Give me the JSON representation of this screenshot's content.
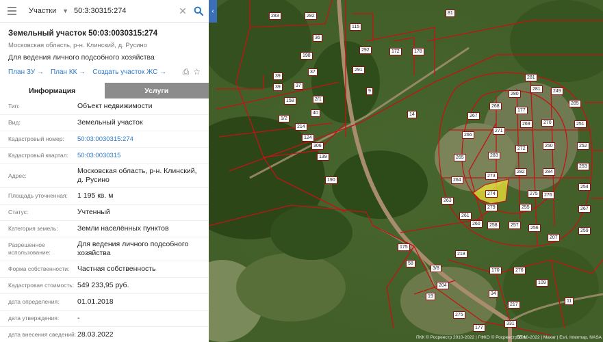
{
  "search": {
    "layer": "Участки",
    "query": "50:3:30315:274"
  },
  "header": {
    "title": "Земельный участок 50:03:0030315:274",
    "address": "Московская область, р-н. Клинский, д. Русино",
    "purpose": "Для ведения личного подсобного хозяйства",
    "links": [
      "План ЗУ →",
      "План КК →",
      "Создать участок ЖС →"
    ]
  },
  "tabs": [
    {
      "label": "Информация"
    },
    {
      "label": "Услуги"
    }
  ],
  "info": [
    {
      "key": "Тип:",
      "value": "Объект недвижимости"
    },
    {
      "key": "Вид:",
      "value": "Земельный участок"
    },
    {
      "key": "Кадастровый номер:",
      "value": "50:03:0030315:274"
    },
    {
      "key": "Кадастровый квартал:",
      "value": "50:03:0030315"
    },
    {
      "key": "Адрес:",
      "value": "Московская область, р-н. Клинский, д. Русино"
    },
    {
      "key": "Площадь уточненная:",
      "value": "1 195 кв. м"
    },
    {
      "key": "Статус:",
      "value": "Учтенный"
    },
    {
      "key": "Категория земель:",
      "value": "Земли населённых пунктов"
    },
    {
      "key": "Разрешенное использование:",
      "value": "Для ведения личного подсобного хозяйства"
    },
    {
      "key": "Форма собственности:",
      "value": "Частная собственность"
    },
    {
      "key": "Кадастровая стоимость:",
      "value": "549 233,95 руб."
    },
    {
      "key": "дата определения:",
      "value": "01.01.2018"
    },
    {
      "key": "дата утверждения:",
      "value": "-"
    },
    {
      "key": "дата внесения сведений:",
      "value": "28.03.2022"
    }
  ],
  "map": {
    "selected_label": "274",
    "scale": "60 м",
    "attribution": "ПКК © Росреестр 2010-2022 | ГФКО © Росреестр 2010-2022 | Maxar | Esri, Intermap, NASA",
    "labels": [
      "283",
      "282",
      "81",
      "115",
      "36",
      "292",
      "172",
      "178",
      "198",
      "37",
      "291",
      "39",
      "39",
      "37",
      "9",
      "281",
      "280",
      "281",
      "249",
      "158",
      "14",
      "268",
      "285",
      "177",
      "2/1",
      "40",
      "267",
      "269",
      "270",
      "251",
      "1/2",
      "214",
      "271",
      "266",
      "124",
      "306",
      "272",
      "250",
      "252",
      "139",
      "283",
      "265",
      "253",
      "273",
      "282",
      "284",
      "190",
      "264",
      "275",
      "276",
      "254",
      "263",
      "279",
      "255",
      "267",
      "261",
      "260",
      "258",
      "256",
      "259",
      "257",
      "207",
      "175",
      "218",
      "58",
      "3/8",
      "204",
      "170",
      "19",
      "34",
      "109",
      "11",
      "177",
      "275",
      "217",
      "331",
      "276"
    ],
    "colors": {
      "boundary": "#c21414",
      "selected_fill": "#f0e63a"
    }
  }
}
